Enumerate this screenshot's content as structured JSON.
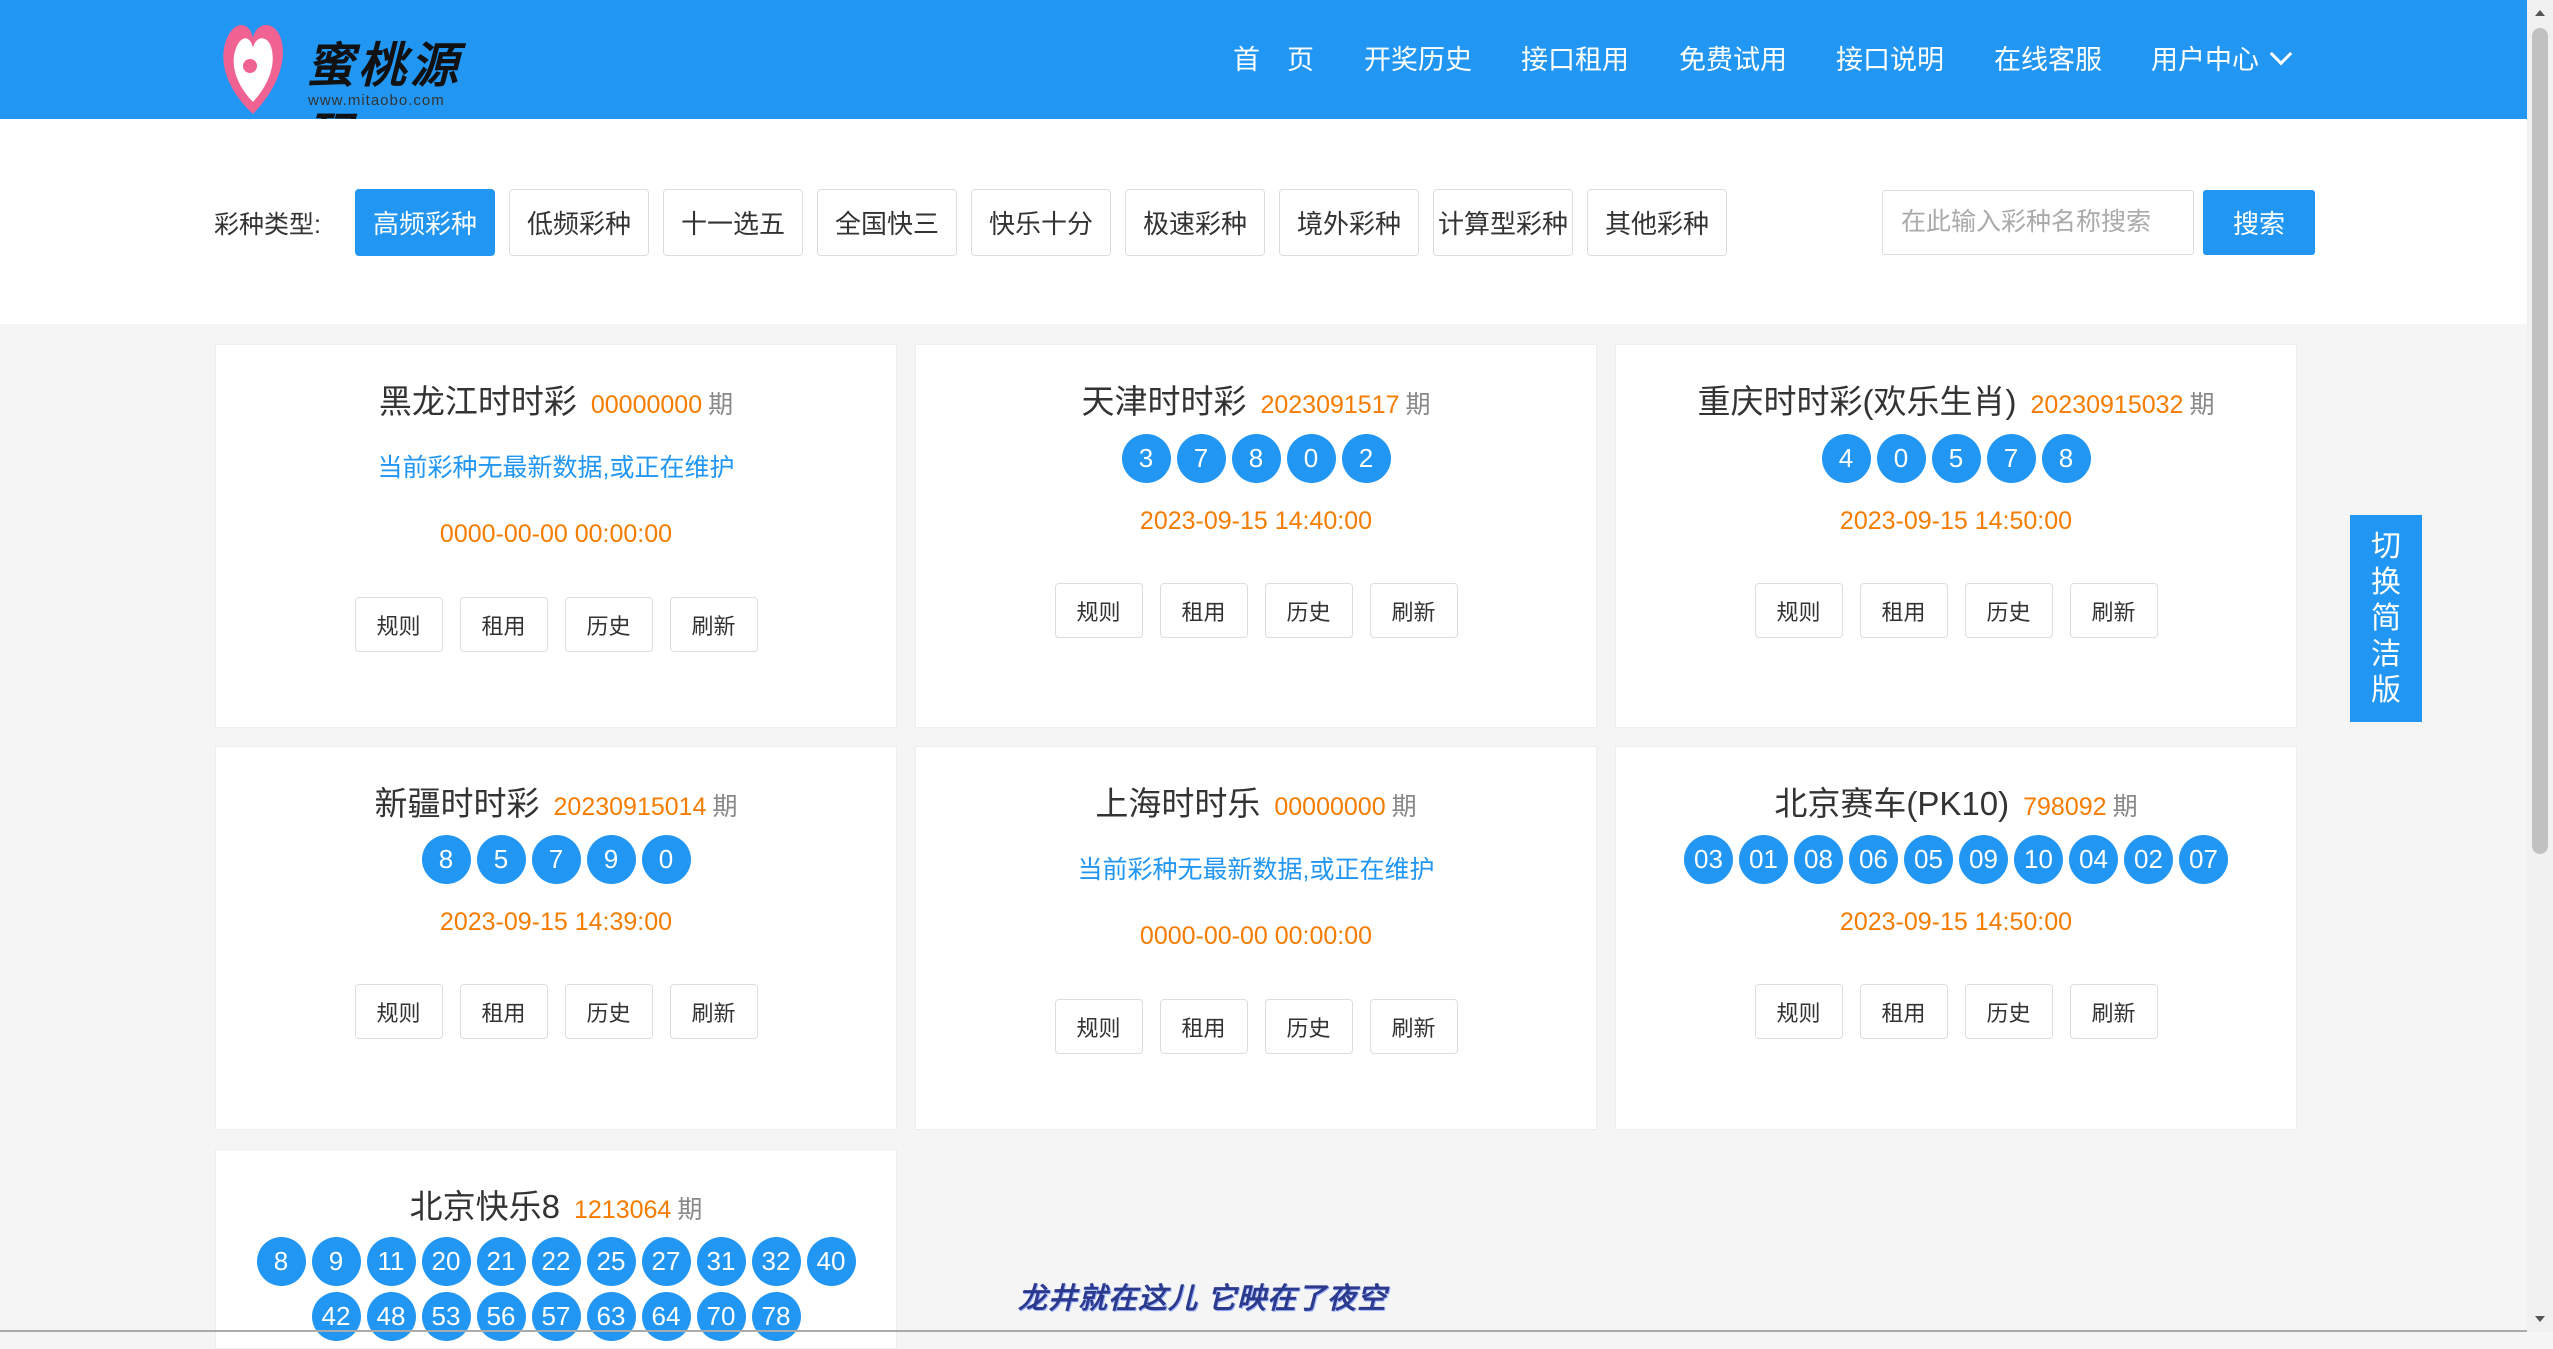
{
  "brand": {
    "name": "蜜桃源码",
    "url": "www.mitaobo.com"
  },
  "nav": [
    {
      "label": "首　页"
    },
    {
      "label": "开奖历史"
    },
    {
      "label": "接口租用"
    },
    {
      "label": "免费试用"
    },
    {
      "label": "接口说明"
    },
    {
      "label": "在线客服"
    },
    {
      "label": "用户中心"
    }
  ],
  "filter": {
    "label": "彩种类型:",
    "types": [
      "高频彩种",
      "低频彩种",
      "十一选五",
      "全国快三",
      "快乐十分",
      "极速彩种",
      "境外彩种",
      "计算型彩种",
      "其他彩种"
    ],
    "active": "高频彩种",
    "search_placeholder": "在此输入彩种名称搜索",
    "search_label": "搜索"
  },
  "qi_label": "期",
  "actions": [
    "规则",
    "租用",
    "历史",
    "刷新"
  ],
  "cards": [
    {
      "name": "黑龙江时时彩",
      "issue": "00000000",
      "notice": "当前彩种无最新数据,或正在维护",
      "balls": [],
      "time": "0000-00-00 00:00:00"
    },
    {
      "name": "天津时时彩",
      "issue": "2023091517",
      "notice": "",
      "balls": [
        "3",
        "7",
        "8",
        "0",
        "2"
      ],
      "time": "2023-09-15 14:40:00"
    },
    {
      "name": "重庆时时彩(欢乐生肖)",
      "issue": "20230915032",
      "notice": "",
      "balls": [
        "4",
        "0",
        "5",
        "7",
        "8"
      ],
      "time": "2023-09-15 14:50:00"
    },
    {
      "name": "新疆时时彩",
      "issue": "20230915014",
      "notice": "",
      "balls": [
        "8",
        "5",
        "7",
        "9",
        "0"
      ],
      "time": "2023-09-15 14:39:00"
    },
    {
      "name": "上海时时乐",
      "issue": "00000000",
      "notice": "当前彩种无最新数据,或正在维护",
      "balls": [],
      "time": "0000-00-00 00:00:00"
    },
    {
      "name": "北京赛车(PK10)",
      "issue": "798092",
      "notice": "",
      "balls": [
        "03",
        "01",
        "08",
        "06",
        "05",
        "09",
        "10",
        "04",
        "02",
        "07"
      ],
      "time": "2023-09-15 14:50:00"
    },
    {
      "name": "北京快乐8",
      "issue": "1213064",
      "notice": "",
      "balls": [
        "8",
        "9",
        "11",
        "20",
        "21",
        "22",
        "25",
        "27",
        "31",
        "32",
        "40",
        "42",
        "48",
        "53",
        "56",
        "57",
        "63",
        "64",
        "70",
        "78"
      ],
      "time": ""
    }
  ],
  "side_switch": [
    "切",
    "换",
    "简",
    "洁",
    "版"
  ],
  "ticker": "龙井就在这儿 它映在了夜空",
  "colors": {
    "primary": "#2196f3",
    "issue": "#f57c00",
    "logo_pink": "#f06292"
  }
}
